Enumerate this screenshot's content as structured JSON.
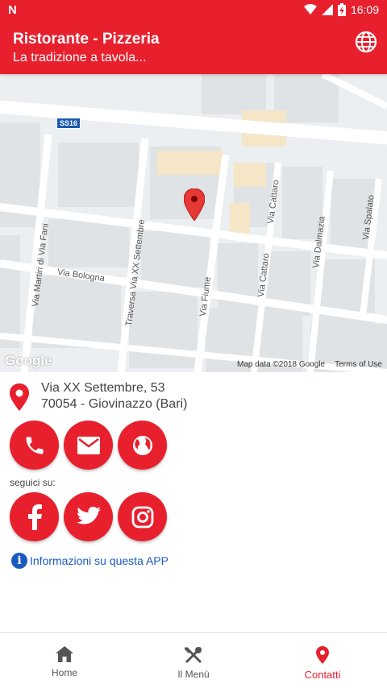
{
  "status_bar": {
    "time": "16:09",
    "notification_icon": "n-logo",
    "battery_icon": "battery-charging-icon"
  },
  "app_bar": {
    "title": "Ristorante - Pizzeria",
    "subtitle": "La tradizione a tavola...",
    "action_icon": "globe-icon"
  },
  "map": {
    "roads": [
      "SS16",
      "Via Martiri di Via Fani",
      "Traversa Via XX Settembre",
      "Via Bologna",
      "Via Fiume",
      "Via Cattaro",
      "Via Cattaro",
      "Via Dalmazia",
      "Via Spalato"
    ],
    "logo": "Google",
    "map_data": "Map data ©2018 Google",
    "terms": "Terms of Use"
  },
  "address": {
    "street": "Via XX Settembre, 53",
    "city": "70054 - Giovinazzo (Bari)"
  },
  "contact_buttons": [
    "phone-icon",
    "email-icon",
    "web-icon"
  ],
  "follow": {
    "label": "seguici su:",
    "social_buttons": [
      "facebook-icon",
      "twitter-icon",
      "instagram-icon"
    ]
  },
  "info_link": {
    "label": "Informazioni su questa APP"
  },
  "bottom_nav": {
    "items": [
      {
        "label": "Home",
        "icon": "home-icon"
      },
      {
        "label": "Il Menù",
        "icon": "cutlery-icon"
      },
      {
        "label": "Contatti",
        "icon": "location-pin-icon",
        "active": true
      }
    ]
  },
  "colors": {
    "primary": "#e8202e",
    "link": "#1a5bbf"
  }
}
